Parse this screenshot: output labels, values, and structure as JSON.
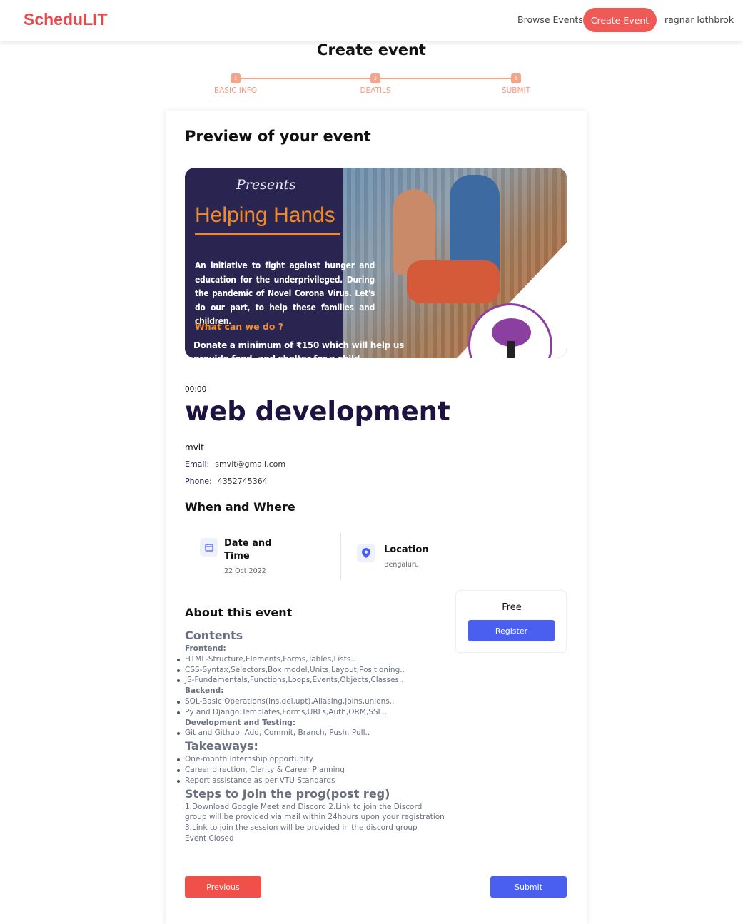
{
  "nav": {
    "logo": "ScheduLIT",
    "browse_events": "Browse Events",
    "create_event": "Create Event",
    "user_name": "ragnar lothbrok"
  },
  "page": {
    "title": "Create event"
  },
  "stepper": {
    "steps": [
      {
        "number": "1",
        "label": "BASIC INFO"
      },
      {
        "number": "2",
        "label": "DEATILS"
      },
      {
        "number": "3",
        "label": "SUBMIT"
      }
    ],
    "accent_color": "#f4a48a"
  },
  "preview": {
    "title": "Preview of your event",
    "banner": {
      "presents": "Presents",
      "heading": "Helping Hands",
      "description": "An initiative to fight against hunger and education for the underprivileged. During the pandemic of Novel Corona Virus. Let's do our part, to help these families and children.",
      "question": "What can we do ?",
      "donate": "Donate a minimum of ₹150 which will help us",
      "donate_cont": "provide food, and shelter for a child"
    },
    "time": "00:00",
    "event_title": "web development",
    "organizer": "mvit",
    "email_label": "Email:",
    "email": "smvit@gmail.com",
    "phone_label": "Phone:",
    "phone": "4352745364"
  },
  "when_where": {
    "title": "When and Where",
    "date_heading": "Date and Time",
    "date_value": "22 Oct 2022",
    "location_heading": "Location",
    "location_value": "Bengaluru"
  },
  "ticket": {
    "price": "Free",
    "register_label": "Register"
  },
  "about": {
    "title": "About this event",
    "contents_heading": "Contents",
    "frontend_heading": "Frontend:",
    "frontend_items": [
      "HTML-Structure,Elements,Forms,Tables,Lists..",
      "CSS-Syntax,Selectors,Box model,Units,Layout,Positioning..",
      "JS-Fundamentals,Functions,Loops,Events,Objects,Classes.."
    ],
    "backend_heading": "Backend:",
    "backend_items": [
      "SQL-Basic Operations(Ins,del,upt),Aliasing,joins,unions..",
      "Py and Django:Templates,Forms,URLs,Auth,ORM,SSL.."
    ],
    "devtest_heading": "Development and Testing:",
    "devtest_items": [
      "Git and Github: Add, Commit, Branch, Push, Pull.."
    ],
    "takeaways_heading": "Takeaways:",
    "takeaways_items": [
      "One-month Internship opportunity",
      "Career direction, Clarity & Career Planning",
      "Report assistance as per VTU Standards"
    ],
    "steps_heading": "Steps to Join the prog(post reg)",
    "steps_text": "1.Download Google Meet and Discord 2.Link to join the Discord group will be provided via mail within 24hours upon your registration 3.Link to join the session will be provided in the discord group",
    "closing": "Event Closed"
  },
  "actions": {
    "previous": "Previous",
    "submit": "Submit"
  },
  "colors": {
    "brand": "#e8484a",
    "primary_button": "#4a5ef0",
    "danger_button": "#f0504a",
    "title_dark": "#1e1340"
  }
}
